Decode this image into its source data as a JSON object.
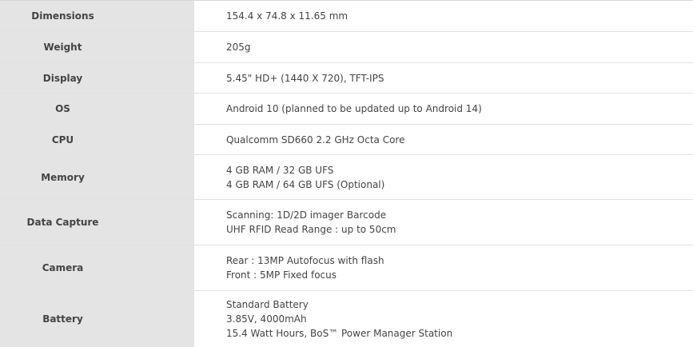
{
  "specs": [
    {
      "label": "Dimensions",
      "values": [
        "154.4 x 74.8 x 11.65 mm"
      ]
    },
    {
      "label": "Weight",
      "values": [
        "205g"
      ]
    },
    {
      "label": "Display",
      "values": [
        "5.45\" HD+ (1440 X 720), TFT-IPS"
      ]
    },
    {
      "label": "OS",
      "values": [
        "Android 10 (planned to be updated up to Android 14)"
      ]
    },
    {
      "label": "CPU",
      "values": [
        "Qualcomm SD660 2.2 GHz Octa Core"
      ]
    },
    {
      "label": "Memory",
      "values": [
        "4 GB RAM / 32 GB UFS",
        "4 GB RAM / 64 GB UFS (Optional)"
      ]
    },
    {
      "label": "Data Capture",
      "values": [
        "Scanning: 1D/2D imager Barcode",
        "UHF RFID Read Range : up to 50cm"
      ]
    },
    {
      "label": "Camera",
      "values": [
        "Rear : 13MP Autofocus with flash",
        "Front : 5MP Fixed focus"
      ]
    },
    {
      "label": "Battery",
      "values": [
        "Standard Battery",
        "3.85V, 4000mAh",
        "15.4 Watt Hours, BoS™ Power Manager Station"
      ]
    }
  ]
}
